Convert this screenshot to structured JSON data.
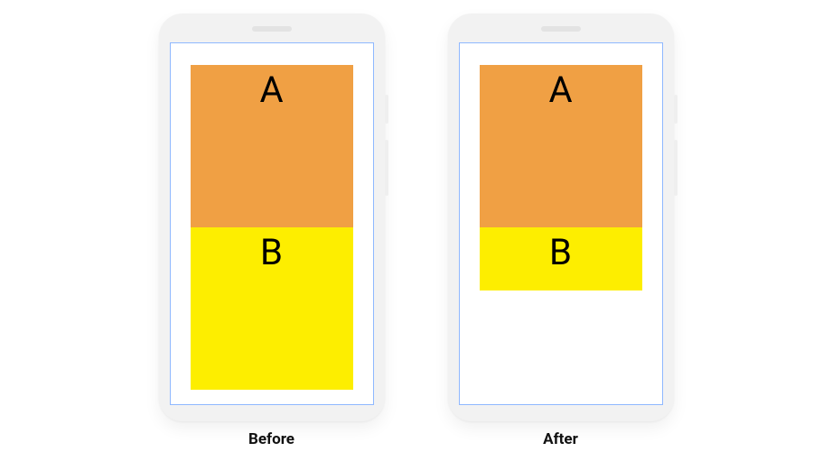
{
  "diagram": {
    "before": {
      "caption": "Before",
      "block_a_label": "A",
      "block_b_label": "B"
    },
    "after": {
      "caption": "After",
      "block_a_label": "A",
      "block_b_label": "B"
    }
  },
  "colors": {
    "block_a": "#f0a044",
    "block_b": "#fdee00",
    "phone_body": "#f2f2f2",
    "screen_border": "#8fb8ff"
  }
}
